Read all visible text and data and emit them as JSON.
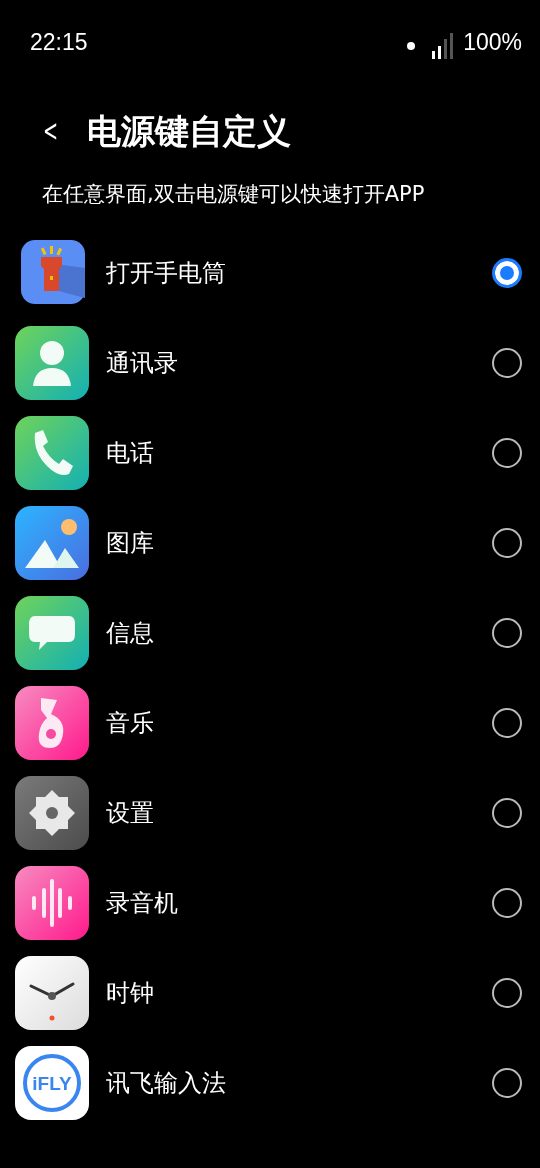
{
  "status_bar": {
    "time": "22:15",
    "battery": "100%"
  },
  "header": {
    "back": "<",
    "title": "电源键自定义"
  },
  "description": "在任意界面,双击电源键可以快速打开APP",
  "apps": [
    {
      "kind": "flashlight",
      "label": "打开手电筒",
      "selected": true
    },
    {
      "kind": "contacts",
      "label": "通讯录",
      "selected": false
    },
    {
      "kind": "phone",
      "label": "电话",
      "selected": false
    },
    {
      "kind": "gallery",
      "label": "图库",
      "selected": false
    },
    {
      "kind": "messages",
      "label": "信息",
      "selected": false
    },
    {
      "kind": "music",
      "label": "音乐",
      "selected": false
    },
    {
      "kind": "settings",
      "label": "设置",
      "selected": false
    },
    {
      "kind": "recorder",
      "label": "录音机",
      "selected": false
    },
    {
      "kind": "clock",
      "label": "时钟",
      "selected": false
    },
    {
      "kind": "ifly",
      "label": "讯飞输入法",
      "selected": false,
      "icon_text": "iFLY"
    }
  ]
}
